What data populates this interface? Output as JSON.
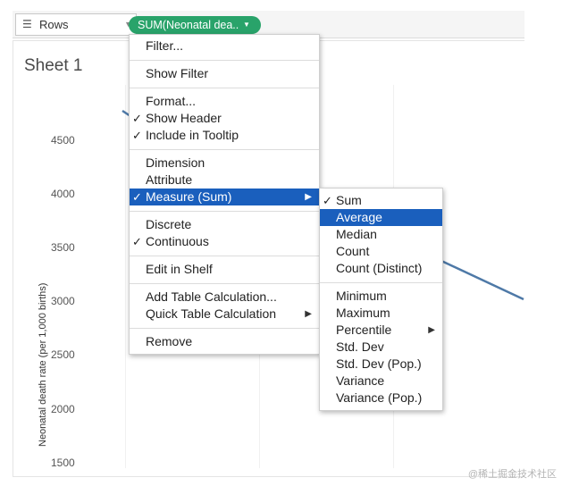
{
  "shelf": {
    "rows_label": "Rows",
    "rows_icon": "list-icon",
    "pill_label": "SUM(Neonatal dea..",
    "pill_color": "#29a36a"
  },
  "sheet": {
    "title": "Sheet 1"
  },
  "chart": {
    "ylabel": "Neonatal death rate (per 1,000 births)",
    "ticks": [
      "4500",
      "4000",
      "3500",
      "3000",
      "2500",
      "2000",
      "1500"
    ],
    "line_color": "#4e79a7"
  },
  "menu": {
    "items": [
      {
        "label": "Filter..."
      },
      {
        "label": "Show Filter"
      },
      {
        "label": "Format..."
      },
      {
        "label": "Show Header",
        "checked": true
      },
      {
        "label": "Include in Tooltip",
        "checked": true
      },
      {
        "label": "Dimension"
      },
      {
        "label": "Attribute"
      },
      {
        "label": "Measure (Sum)",
        "checked": true,
        "submenu": true,
        "highlighted": true
      },
      {
        "label": "Discrete"
      },
      {
        "label": "Continuous",
        "checked": true
      },
      {
        "label": "Edit in Shelf"
      },
      {
        "label": "Add Table Calculation..."
      },
      {
        "label": "Quick Table Calculation",
        "submenu": true
      },
      {
        "label": "Remove"
      }
    ]
  },
  "submenu": {
    "items": [
      {
        "label": "Sum",
        "checked": true
      },
      {
        "label": "Average",
        "highlighted": true
      },
      {
        "label": "Median"
      },
      {
        "label": "Count"
      },
      {
        "label": "Count (Distinct)"
      },
      {
        "label": "Minimum"
      },
      {
        "label": "Maximum"
      },
      {
        "label": "Percentile",
        "submenu": true
      },
      {
        "label": "Std. Dev"
      },
      {
        "label": "Std. Dev (Pop.)"
      },
      {
        "label": "Variance"
      },
      {
        "label": "Variance (Pop.)"
      }
    ]
  },
  "watermark": "@稀土掘金技术社区",
  "highlight_color": "#1a5fbd"
}
